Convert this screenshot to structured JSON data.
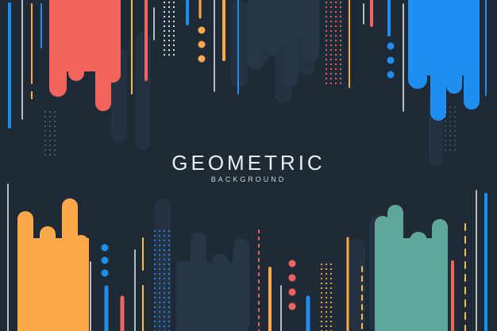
{
  "title": "GEOMETRIC",
  "subtitle": "BACKGROUND",
  "colors": {
    "background": "#1e2a36",
    "dark_shape": "#273644",
    "red": "#f2645c",
    "blue": "#1f8ef1",
    "orange": "#fba94b",
    "teal": "#5fa69b",
    "yellow": "#f6c04a",
    "white": "#e9eef2"
  }
}
